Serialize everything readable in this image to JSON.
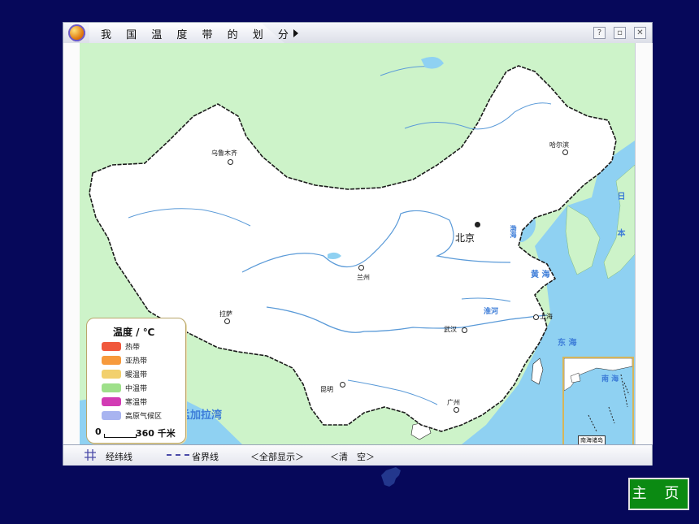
{
  "window": {
    "title": "我 国 温 度 带 的 划 分",
    "help_button": "?",
    "restore_button": "▫",
    "close_button": "✕"
  },
  "map": {
    "cities": {
      "urumqi": "乌鲁木齐",
      "harbin": "哈尔滨",
      "beijing": "北京",
      "lanzhou": "兰州",
      "lhasa": "拉萨",
      "shanghai": "上海",
      "wuhan": "武汉",
      "kunming": "昆明",
      "guangzhou": "广州"
    },
    "water": {
      "bohai": "渤海",
      "huanghai": "黄 海",
      "donghai": "东 海",
      "nanhai": "南 海",
      "riben": "日 本",
      "bay_of_bengal": "孟加拉湾",
      "huaihe": "淮河"
    },
    "inset": {
      "label": "南海诸岛",
      "sea": "南 海"
    }
  },
  "legend": {
    "title": "温度 / ℃",
    "items": [
      {
        "label": "热带",
        "color": "#f0583c"
      },
      {
        "label": "亚热带",
        "color": "#f79a3c"
      },
      {
        "label": "暖温带",
        "color": "#f2d06e"
      },
      {
        "label": "中温带",
        "color": "#9ee08a"
      },
      {
        "label": "寒温带",
        "color": "#d23cb4"
      },
      {
        "label": "高原气候区",
        "color": "#a8b4f0"
      }
    ],
    "scale_zero": "0",
    "scale_text": "360 千米"
  },
  "toolbar": {
    "graticule": "经纬线",
    "province_border": "省界线",
    "show_all": "＜全部显示＞",
    "clear": "＜清　空＞"
  },
  "home_button": "主 页",
  "colors": {
    "background": "#06085a",
    "land_foreign": "#cdf3c9",
    "sea": "#8fd1f2",
    "china": "#ffffff",
    "river": "#5a9ad8"
  }
}
